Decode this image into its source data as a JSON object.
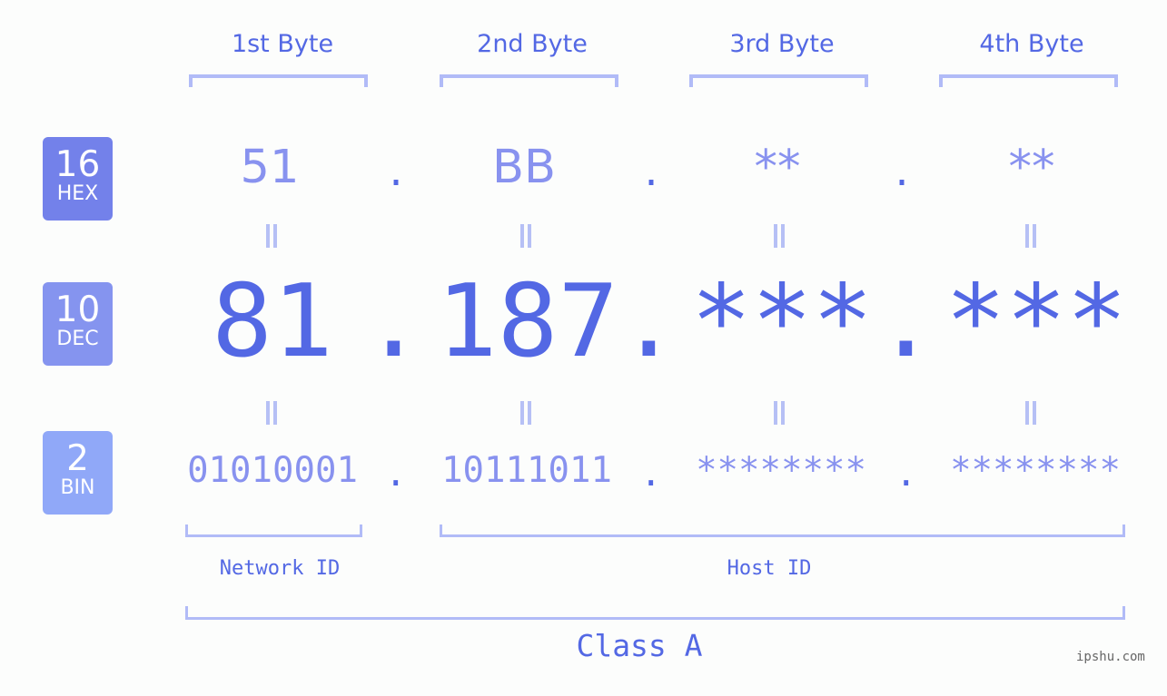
{
  "headers": [
    "1st Byte",
    "2nd Byte",
    "3rd Byte",
    "4th Byte"
  ],
  "badges": {
    "hex": {
      "num": "16",
      "label": "HEX",
      "color": "#7381ea"
    },
    "dec": {
      "num": "10",
      "label": "DEC",
      "color": "#8594ef"
    },
    "bin": {
      "num": "2",
      "label": "BIN",
      "color": "#90a8f8"
    }
  },
  "hex_values": [
    "51",
    "BB",
    "**",
    "**"
  ],
  "dec_values": [
    "81",
    "187",
    "***",
    "***"
  ],
  "bin_values": [
    "01010001",
    "10111011",
    "********",
    "********"
  ],
  "separator": ".",
  "network_label": "Network ID",
  "host_label": "Host ID",
  "class_label": "Class A",
  "watermark": "ipshu.com",
  "colors": {
    "primary": "#5368e4",
    "light": "#8892ef",
    "bracket": "#b1bbf7",
    "background": "#fcfdfc"
  }
}
